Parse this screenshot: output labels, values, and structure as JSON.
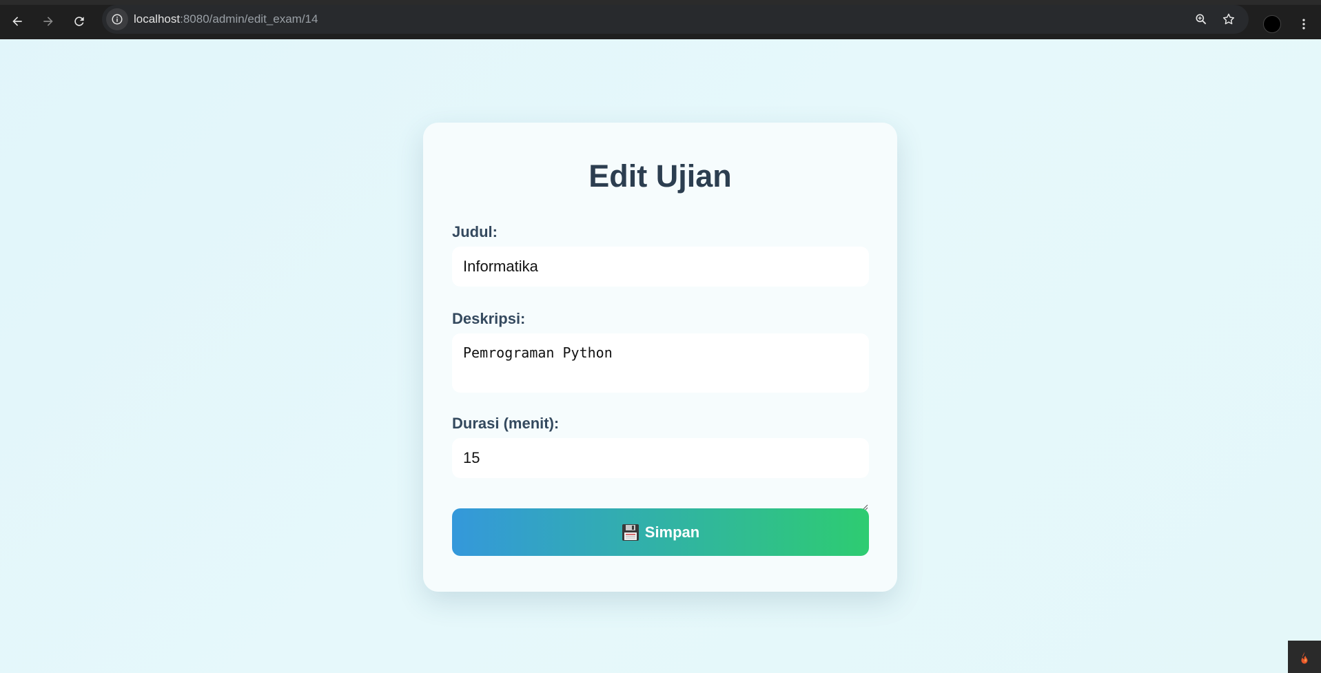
{
  "browser": {
    "url_host": "localhost",
    "url_path": ":8080/admin/edit_exam/14"
  },
  "form": {
    "title": "Edit Ujian",
    "judul_label": "Judul:",
    "judul_value": "Informatika",
    "deskripsi_label": "Deskripsi:",
    "deskripsi_value": "Pemrograman Python",
    "durasi_label": "Durasi (menit):",
    "durasi_value": "15",
    "save_label": "Simpan"
  },
  "icons": {
    "back": "back-arrow-icon",
    "forward": "forward-arrow-icon",
    "reload": "reload-icon",
    "site_info": "info-icon",
    "zoom": "zoom-icon",
    "bookmark": "star-icon",
    "menu": "kebab-menu-icon",
    "save": "floppy-disk-icon",
    "corner": "flame-icon"
  },
  "colors": {
    "heading": "#2c3e50",
    "button_start": "#3498db",
    "button_end": "#2ecc71"
  }
}
